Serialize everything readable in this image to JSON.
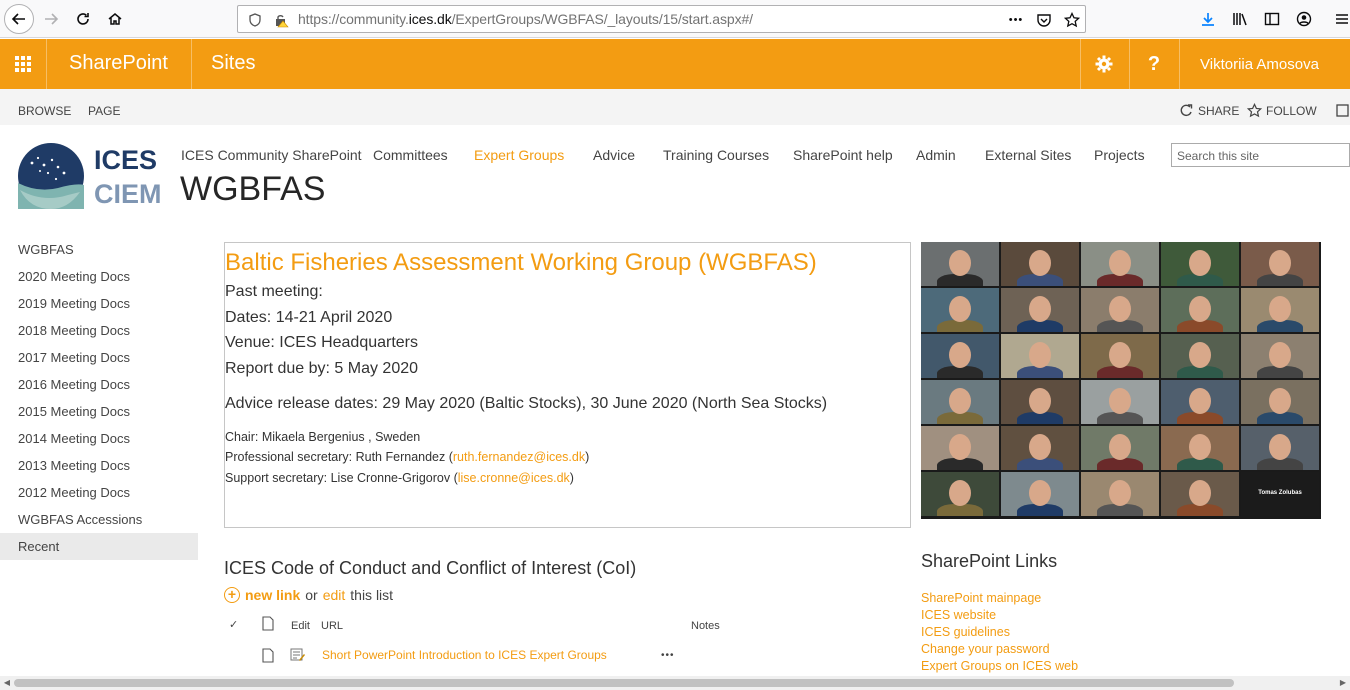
{
  "browser": {
    "url_prefix": "https://community.",
    "url_domain": "ices.dk",
    "url_path": "/ExpertGroups/WGBFAS/_layouts/15/start.aspx#/",
    "more_glyph": "•••"
  },
  "suite": {
    "brand": "SharePoint",
    "sites": "Sites",
    "help": "?",
    "user": "Viktoriia Amosova",
    "accent": "#f39c12"
  },
  "ribbon": {
    "browse": "BROWSE",
    "page": "PAGE",
    "share": "SHARE",
    "follow": "FOLLOW"
  },
  "logo": {
    "line1": "ICES",
    "line2": "CIEM"
  },
  "topnav": {
    "items": [
      "ICES Community SharePoint",
      "Committees",
      "Expert Groups",
      "Advice",
      "Training Courses",
      "SharePoint help",
      "Admin",
      "External Sites",
      "Projects"
    ],
    "search_placeholder": "Search this site"
  },
  "site_title": "WGBFAS",
  "leftnav": {
    "items": [
      "WGBFAS",
      "2020 Meeting Docs",
      "2019 Meeting Docs",
      "2018 Meeting Docs",
      "2017 Meeting Docs",
      "2016 Meeting Docs",
      "2015 Meeting Docs",
      "2014 Meeting Docs",
      "2013 Meeting Docs",
      "2012 Meeting Docs",
      "WGBFAS Accessions",
      "Recent"
    ]
  },
  "info": {
    "heading": "Baltic Fisheries Assessment Working Group (WGBFAS)",
    "past_meeting": "Past meeting:",
    "dates": "Dates: 14-21 April 2020",
    "venue": "Venue: ICES Headquarters",
    "report": "Report due by: 5 May 2020",
    "advice": "Advice release dates: 29 May 2020 (Baltic Stocks), 30 June 2020 (North Sea Stocks)",
    "chair": "Chair:  Mikaela Bergenius , Sweden",
    "prof_sec_label": "Professional secretary: Ruth Fernandez (",
    "prof_sec_email": "ruth.fernandez@ices.dk",
    "support_sec_label": "Support secretary:  Lise Cronne-Grigorov (",
    "support_sec_email": "lise.cronne@ices.dk",
    "close_paren": ")"
  },
  "photo_grid": {
    "black_tile_name": "Tomas Zolubas"
  },
  "coc": {
    "title": "ICES Code of Conduct and Conflict of Interest (CoI)",
    "new_link": "new link",
    "or": "or",
    "edit": "edit",
    "this_list": "this list",
    "col_edit": "Edit",
    "col_url": "URL",
    "col_notes": "Notes",
    "row_url": "Short PowerPoint Introduction to ICES Expert Groups",
    "row_more": "•••"
  },
  "sp_links": {
    "title": "SharePoint Links",
    "items": [
      "SharePoint mainpage",
      "ICES website",
      "ICES guidelines",
      "Change your password",
      "Expert Groups on ICES web"
    ]
  }
}
